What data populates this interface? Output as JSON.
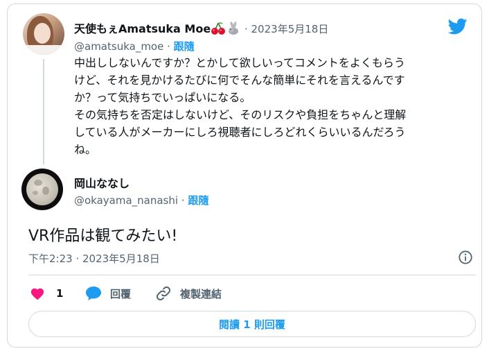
{
  "quoted_tweet": {
    "display_name": "天使もぇAmatsuka Moe",
    "emojis": [
      "cherries-emoji",
      "rabbit-emoji"
    ],
    "date": "2023年5月18日",
    "handle": "@amatsuka_moe",
    "follow_label": "跟隨",
    "text_lines": [
      "中出ししないんですか？とかして欲しいってコメントをよくもらう",
      "けど、それを見かけるたびに何でそんな簡単にそれを言えるんです",
      "か？って気持ちでいっぱいになる。",
      "その気持ちを否定はしないけど、そのリスクや負担をちゃんと理解",
      "している人がメーカーにしろ視聴者にしろどれくらいいるんだろう",
      "ね。"
    ]
  },
  "reply_tweet": {
    "display_name": "岡山ななし",
    "handle": "@okayama_nanashi",
    "follow_label": "跟隨",
    "text": "VR作品は観てみたい!",
    "timestamp": "下午2:23 · 2023年5月18日"
  },
  "actions": {
    "like_count": "1",
    "reply_label": "回覆",
    "copy_link_label": "複製連結"
  },
  "read_replies_label": "閱讀 1 則回覆",
  "colors": {
    "accent": "#1d9bf0",
    "like": "#f91880",
    "muted": "#536471",
    "border": "#cfd9de"
  },
  "separator": " · "
}
